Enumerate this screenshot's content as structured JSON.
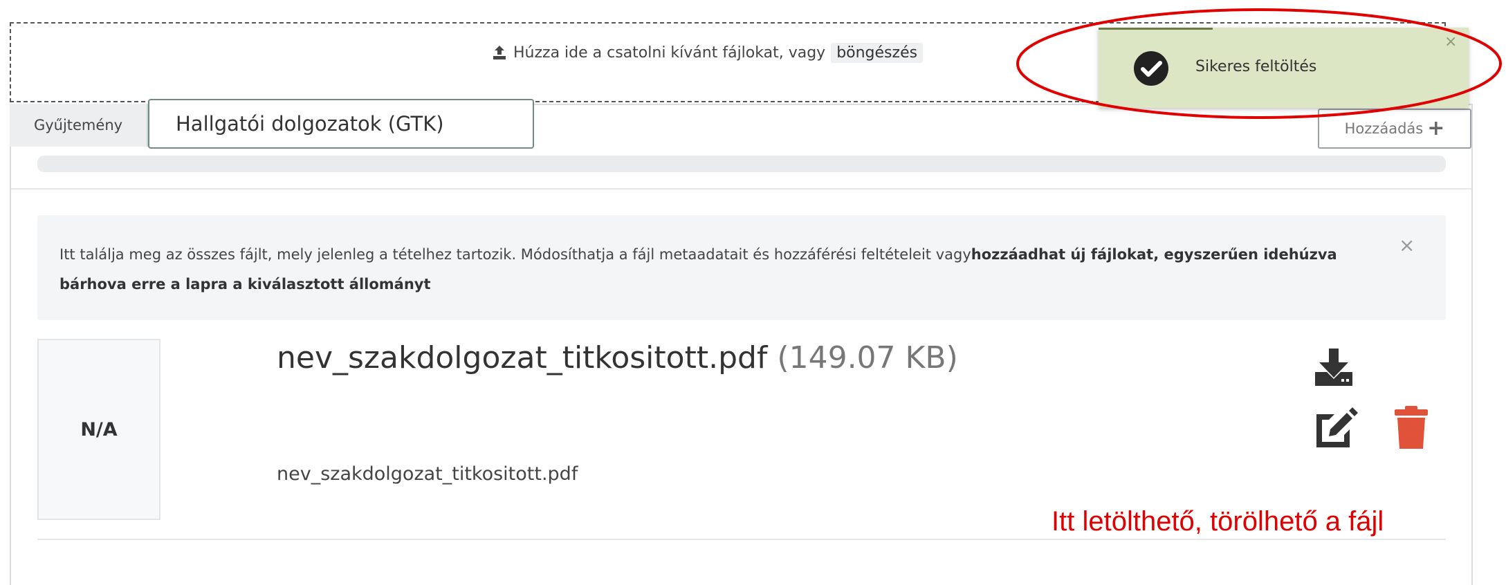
{
  "dropzone": {
    "icon": "upload-icon",
    "text": "Húzza ide a csatolni kívánt fájlokat, vagy",
    "browse_label": "böngészés"
  },
  "collection": {
    "label": "Gyűjtemény",
    "value": "Hallgatói dolgozatok (GTK)",
    "add_label": "Hozzáadás",
    "add_icon": "plus-icon"
  },
  "info": {
    "text_normal": "Itt találja meg az összes fájlt, mely jelenleg a tételhez tartozik. Módosíthatja a fájl metaadatait és hozzáférési feltételeit vagy",
    "text_bold": "hozzáadhat új fájlokat, egyszerűen idehúzva bárhova erre a lapra a kiválasztott állományt",
    "close_glyph": "×"
  },
  "file": {
    "thumbnail_label": "N/A",
    "name": "nev_szakdolgozat_titkositott.pdf",
    "size": "(149.07 KB)",
    "description": "nev_szakdolgozat_titkositott.pdf",
    "actions": [
      "download-icon",
      "edit-icon",
      "trash-icon"
    ]
  },
  "toast": {
    "message": "Sikeres feltöltés",
    "close_glyph": "×",
    "icon": "check-circle-icon"
  },
  "annotation": {
    "text": "Itt letölthető, törölhető a fájl",
    "color": "#e00000"
  },
  "colors": {
    "toast_bg": "#dde6c4",
    "delete": "#e0523a",
    "icon_dark": "#333333"
  }
}
